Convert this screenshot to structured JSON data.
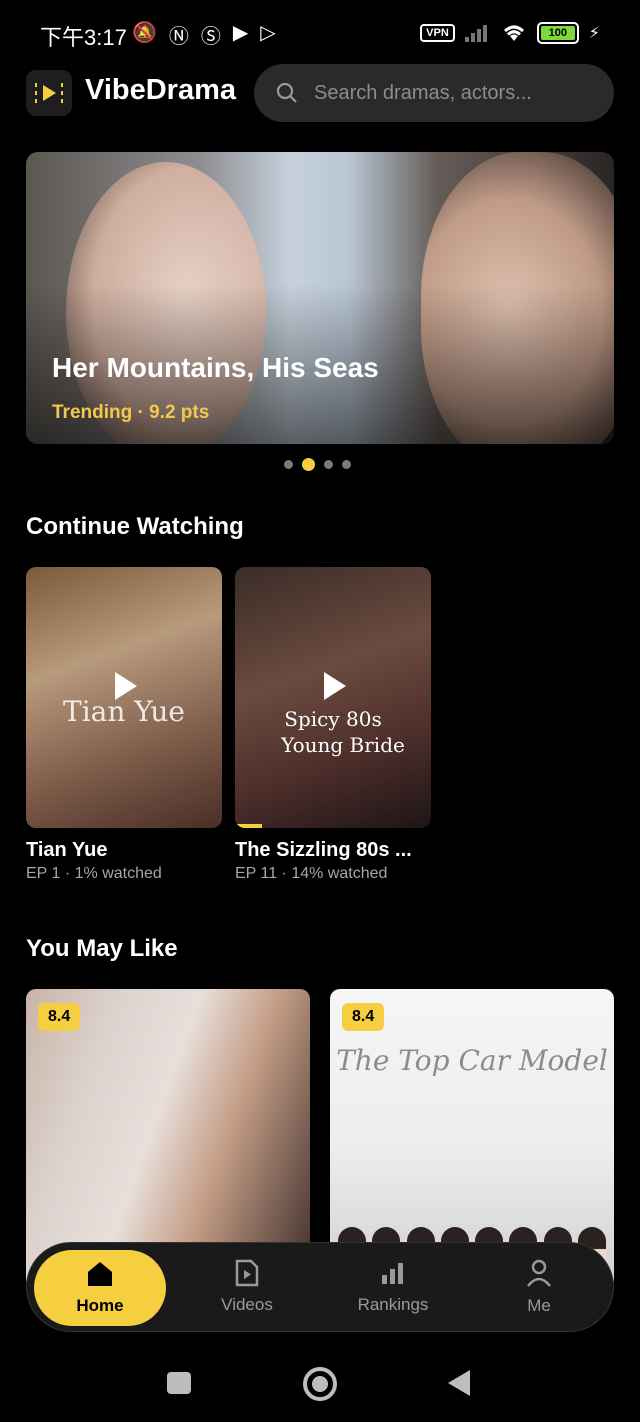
{
  "status_bar": {
    "time": "下午3:17",
    "vpn": "VPN",
    "battery": "100"
  },
  "header": {
    "app_name": "VibeDrama",
    "search_placeholder": "Search dramas, actors..."
  },
  "hero": {
    "title": "Her Mountains, His Seas",
    "subtitle": "Trending · 9.2 pts",
    "page_count": 4,
    "active_page": 2
  },
  "continue_watching": {
    "title": "Continue Watching",
    "items": [
      {
        "title": "Tian Yue",
        "meta": "EP 1 · 1% watched",
        "overlay": [
          "Tian Yue"
        ],
        "progress": 0.01
      },
      {
        "title": "The Sizzling 80s ...",
        "meta": "EP 11 · 14% watched",
        "overlay": [
          "Spicy 80s",
          "Young Bride"
        ],
        "progress": 0.14
      }
    ]
  },
  "you_may_like": {
    "title": "You May Like",
    "items": [
      {
        "rating": "8.4"
      },
      {
        "rating": "8.4",
        "cover_text": "The Top Car Model"
      }
    ]
  },
  "bottom_nav": [
    {
      "label": "Home",
      "icon": "home-icon",
      "active": true
    },
    {
      "label": "Videos",
      "icon": "video-icon",
      "active": false
    },
    {
      "label": "Rankings",
      "icon": "rankings-icon",
      "active": false
    },
    {
      "label": "Me",
      "icon": "profile-icon",
      "active": false
    }
  ],
  "colors": {
    "accent": "#f5cf3f",
    "background": "#000000",
    "surface": "#1a1a1a"
  }
}
